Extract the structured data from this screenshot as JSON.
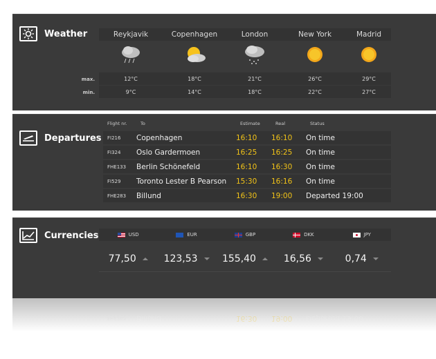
{
  "weather": {
    "title": "Weather",
    "cities": [
      "Reykjavik",
      "Copenhagen",
      "London",
      "New York",
      "Madrid"
    ],
    "icons": [
      "rain-cloud-icon",
      "sun-cloud-icon",
      "storm-cloud-icon",
      "sun-icon",
      "sun-icon"
    ],
    "max_label": "max.",
    "min_label": "min.",
    "max": [
      "12°C",
      "18°C",
      "21°C",
      "26°C",
      "29°C"
    ],
    "min": [
      "9°C",
      "14°C",
      "18°C",
      "22°C",
      "27°C"
    ]
  },
  "departures": {
    "title": "Departures",
    "headers": {
      "flight": "Flight nr.",
      "to": "To",
      "estimate": "Estimate",
      "real": "Real",
      "status": "Status"
    },
    "rows": [
      {
        "flight": "FI216",
        "to": "Copenhagen",
        "estimate": "16:10",
        "real": "16:10",
        "status": "On time"
      },
      {
        "flight": "FI324",
        "to": "Oslo Gardermoen",
        "estimate": "16:25",
        "real": "16:25",
        "status": "On time"
      },
      {
        "flight": "FHE133",
        "to": "Berlin Schönefeld",
        "estimate": "16:10",
        "real": "16:30",
        "status": "On time"
      },
      {
        "flight": "FI529",
        "to": "Toronto Lester B Pearson",
        "estimate": "15:30",
        "real": "16:16",
        "status": "On time"
      },
      {
        "flight": "FHE283",
        "to": "Billund",
        "estimate": "16:30",
        "real": "19:00",
        "status": "Departed 19:00"
      }
    ]
  },
  "currencies": {
    "title": "Currencies",
    "items": [
      {
        "code": "USD",
        "value": "77,50",
        "trend": "up"
      },
      {
        "code": "EUR",
        "value": "123,53",
        "trend": "down"
      },
      {
        "code": "GBP",
        "value": "155,40",
        "trend": "up"
      },
      {
        "code": "DKK",
        "value": "16,56",
        "trend": "down"
      },
      {
        "code": "JPY",
        "value": "0,74",
        "trend": "down"
      }
    ]
  },
  "colors": {
    "panel": "#3a3a3a",
    "row": "#333333",
    "highlight": "#f2c318"
  }
}
